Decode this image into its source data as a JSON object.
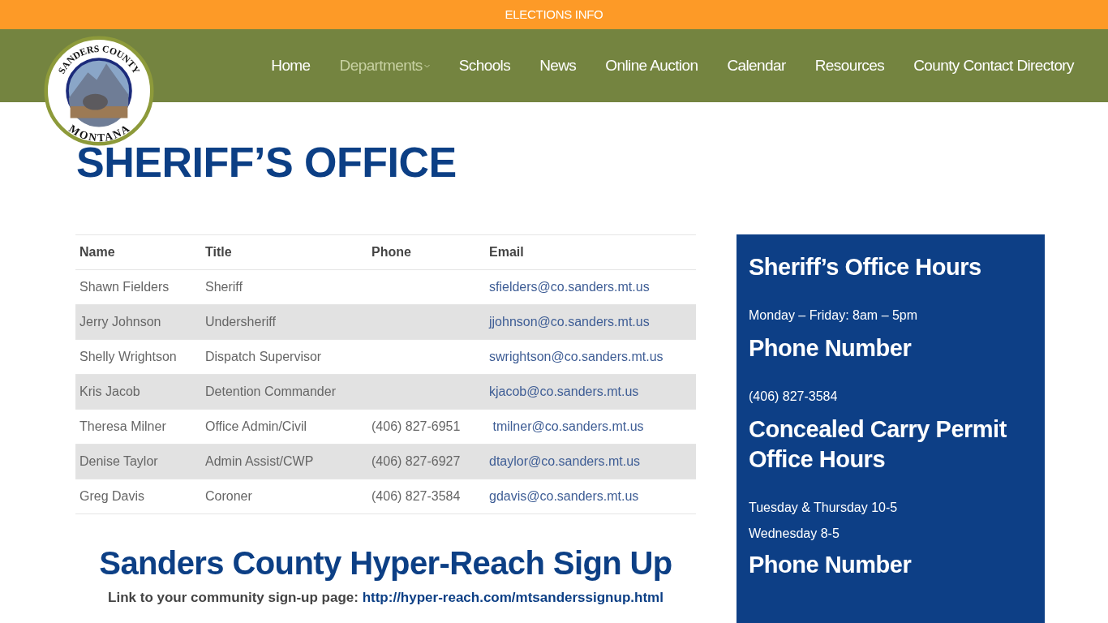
{
  "top_bar": {
    "label": "ELECTIONS INFO"
  },
  "logo": {
    "top_text": "SANDERS COUNTY",
    "bottom_text": "MONTANA"
  },
  "nav": [
    {
      "label": "Home",
      "selected": false,
      "dropdown": false
    },
    {
      "label": "Departments",
      "selected": true,
      "dropdown": true
    },
    {
      "label": "Schools",
      "selected": false,
      "dropdown": false
    },
    {
      "label": "News",
      "selected": false,
      "dropdown": false
    },
    {
      "label": "Online Auction",
      "selected": false,
      "dropdown": false
    },
    {
      "label": "Calendar",
      "selected": false,
      "dropdown": false
    },
    {
      "label": "Resources",
      "selected": false,
      "dropdown": false
    },
    {
      "label": "County Contact Directory",
      "selected": false,
      "dropdown": false
    }
  ],
  "page_title": "SHERIFF’S OFFICE",
  "table": {
    "columns": [
      "Name",
      "Title",
      "Phone",
      "Email"
    ],
    "rows": [
      [
        "Shawn Fielders",
        "Sheriff",
        "",
        "sfielders@co.sanders.mt.us"
      ],
      [
        "Jerry Johnson",
        "Undersheriff",
        "",
        "jjohnson@co.sanders.mt.us"
      ],
      [
        "Shelly Wrightson",
        "Dispatch Supervisor",
        "",
        "swrightson@co.sanders.mt.us"
      ],
      [
        "Kris Jacob",
        "Detention Commander",
        "",
        "kjacob@co.sanders.mt.us"
      ],
      [
        "Theresa Milner",
        "Office Admin/Civil",
        "(406) 827-6951",
        " tmilner@co.sanders.mt.us"
      ],
      [
        "Denise Taylor",
        "Admin Assist/CWP",
        "(406) 827-6927",
        "dtaylor@co.sanders.mt.us"
      ],
      [
        "Greg Davis",
        "Coroner",
        "(406) 827-3584",
        "gdavis@co.sanders.mt.us"
      ]
    ]
  },
  "signup": {
    "heading": "Sanders County Hyper-Reach Sign Up",
    "label": "Link to your community sign-up page:",
    "link": "http://hyper-reach.com/mtsanderssignup.html"
  },
  "sidebar": {
    "items": [
      {
        "kind": "heading",
        "text": "Sheriff’s Office Hours"
      },
      {
        "kind": "text",
        "text": "Monday – Friday: 8am – 5pm"
      },
      {
        "kind": "heading",
        "text": "Phone Number"
      },
      {
        "kind": "text",
        "text": "(406) 827-3584"
      },
      {
        "kind": "heading",
        "text": "Concealed Carry Permit Office Hours"
      },
      {
        "kind": "text",
        "text": "Tuesday & Thursday 10-5"
      },
      {
        "kind": "line",
        "text": "Wednesday 8-5"
      },
      {
        "kind": "heading",
        "text": "Phone Number"
      }
    ]
  }
}
